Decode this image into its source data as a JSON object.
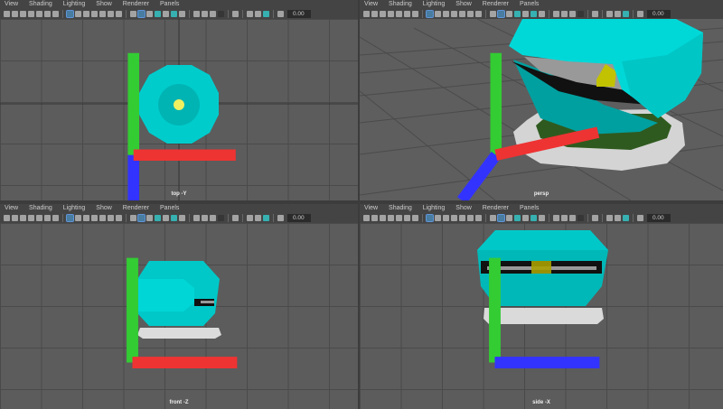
{
  "menu": [
    "View",
    "Shading",
    "Lighting",
    "Show",
    "Renderer",
    "Panels"
  ],
  "toolbar": {
    "icons": [
      "camera",
      "camera-select",
      "camera-lock",
      "bookmark",
      "image-plane",
      "2d-pan",
      "grease-pencil",
      "|",
      "grid",
      "film-gate",
      "resolution-gate",
      "gate-mask",
      "field-chart",
      "safe-action",
      "safe-title",
      "|",
      "wireframe",
      "smooth-shade",
      "default-material",
      "textured",
      "xray",
      "use-all-lights",
      "shadows",
      "|",
      "ambient-occlusion",
      "motion-blur",
      "anti-aliasing",
      "depth-of-field",
      "|",
      "isolate-select",
      "|",
      "xray-active",
      "xray-joints",
      "backface",
      "|",
      "exposure"
    ],
    "exposure_value": "0.00"
  },
  "panels": [
    {
      "camera": "top -Y"
    },
    {
      "camera": "persp"
    },
    {
      "camera": "front -Z"
    },
    {
      "camera": "side -X"
    }
  ],
  "colors": {
    "cyan": "#00d4d4",
    "dark_cyan": "#00a8a8",
    "yellow": "#c8c800",
    "green": "#2f5a1f",
    "silver": "#d8d8d8"
  }
}
